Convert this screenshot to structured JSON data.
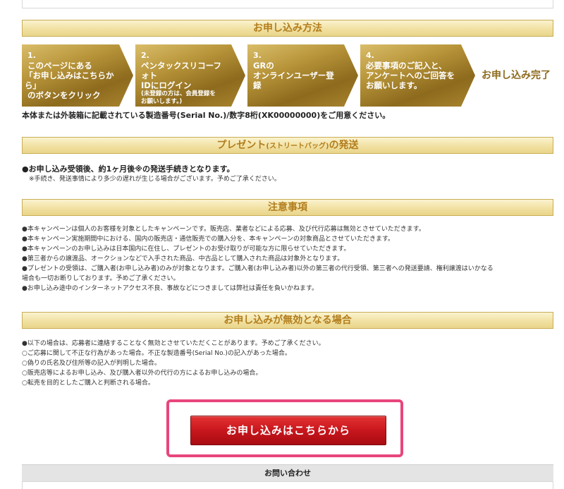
{
  "sections": {
    "method_title": "お申し込み方法",
    "present_title_main": "プレゼント",
    "present_title_sub": "(ストリートバッグ)",
    "present_title_end": "の発送",
    "notes_title": "注意事項",
    "invalid_title": "お申し込みが無効となる場合"
  },
  "steps": [
    {
      "num": "1.",
      "lines": [
        "このページにある",
        "「お申し込みはこちらから」",
        "のボタンをクリック"
      ]
    },
    {
      "num": "2.",
      "lines": [
        "ペンタックスリコーフォト",
        "IDにログイン"
      ],
      "note": [
        "(未登録の方は、会員登録を",
        "お願いします。)"
      ]
    },
    {
      "num": "3.",
      "lines": [
        "GRの",
        "オンラインユーザー登録"
      ]
    },
    {
      "num": "4.",
      "lines": [
        "必要事項のご記入と、",
        "アンケートへのご回答を",
        "お願いします。"
      ]
    }
  ],
  "step_final": "お申し込み完了",
  "serial_text": "本体または外装箱に記載されている製造番号(Serial No.)/数字8桁(XK00000000)をご用意ください。",
  "present": {
    "main": "●お申し込み受領後、約1ヶ月後※の発送手続きとなります。",
    "note": "※手続き、発送事情により多少の遅れが生じる場合がございます。予めご了承ください。"
  },
  "notes": [
    "●本キャンペーンは個人のお客様を対象としたキャンペーンです。販売店、業者などによる応募、及び代行応募は無効とさせていただきます。",
    "●本キャンペーン実施期間中における、国内の販売店・通信販売での購入分を、本キャンペーンの対象商品とさせていただきます。",
    "●本キャンペーンのお申し込みは日本国内に在住し、プレゼントのお受け取りが可能な方に限らせていただきます。",
    "●第三者からの譲渡品、オークションなどで入手された商品、中古品として購入された商品は対象外となります。",
    "●プレゼントの受領は、ご購入者(お申し込み者)のみが対象となります。ご購入者(お申し込み者)以外の第三者の代行受領、第三者への発送要請、権利譲渡はいかなる",
    "場合も一切お断りしております。予めご了承ください。",
    "●お申し込み途中のインターネットアクセス不良、事故などにつきましては弊社は責任を負いかねます。"
  ],
  "invalid": [
    "●以下の場合は、応募者に連絡することなく無効とさせていただくことがあります。予めご了承ください。",
    "○ご応募に関して不正な行為があった場合。不正な製造番号(Serial No.)の記入があった場合。",
    "○偽りの氏名及び住所等の記入が判明した場合。",
    "○販売店等によるお申し込み、及び購入者以外の代行の方によるお申し込みの場合。",
    "○転売を目的としたご購入と判断される場合。"
  ],
  "cta_label": "お申し込みはこちらから",
  "contact_label": "お問い合わせ"
}
